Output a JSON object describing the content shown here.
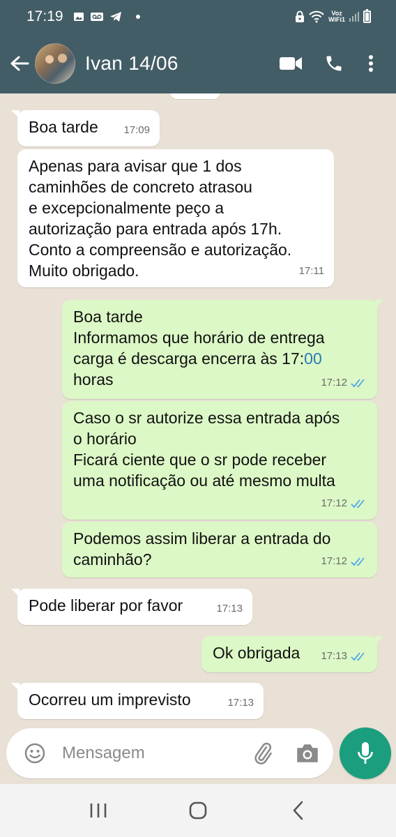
{
  "status_bar": {
    "time": "17:19",
    "carrier_label": "Voz",
    "wifi_label": "WiFi1"
  },
  "header": {
    "contact_name": "Ivan 14/06"
  },
  "messages": [
    {
      "direction": "in",
      "text": "Boa tarde",
      "time": "17:09"
    },
    {
      "direction": "in",
      "text": "Apenas para avisar que 1 dos\ncaminhões de concreto atrasou\ne excepcionalmente peço a\nautorização para entrada após 17h.\nConto a compreensão e autorização.\nMuito obrigado.",
      "time": "17:11"
    },
    {
      "direction": "out",
      "text_before": "Boa tarde\nInformamos que horário de entrega\ncarga é descarga encerra às 17:",
      "text_highlight": "00",
      "text_after": "\nhoras",
      "time": "17:12",
      "status": "read"
    },
    {
      "direction": "out",
      "text": "Caso o sr autorize essa entrada após\no horário\nFicará ciente que o sr pode receber\numa notificação ou até mesmo multa",
      "time": "17:12",
      "status": "read"
    },
    {
      "direction": "out",
      "text": "Podemos assim liberar a entrada do\ncaminhão?",
      "time": "17:12",
      "status": "read"
    },
    {
      "direction": "in",
      "text": "Pode liberar por favor",
      "time": "17:13"
    },
    {
      "direction": "out",
      "text": "Ok obrigada",
      "time": "17:13",
      "status": "read"
    },
    {
      "direction": "in",
      "text": "Ocorreu um imprevisto",
      "time": "17:13"
    }
  ],
  "composer": {
    "placeholder": "Mensagem"
  },
  "colors": {
    "header": "#435d66",
    "chat_background": "#e9e1d6",
    "incoming_bubble": "#ffffff",
    "outgoing_bubble": "#dcf8c6",
    "read_ticks": "#4fa6e8",
    "mic_button": "#1b9e7e"
  }
}
